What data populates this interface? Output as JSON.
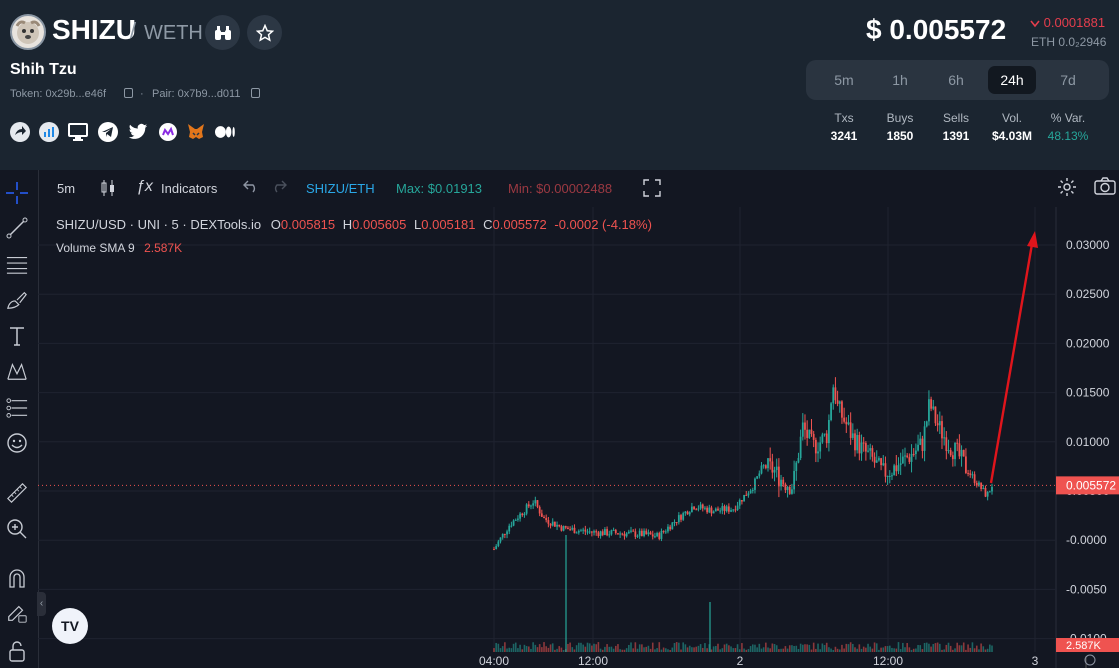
{
  "token": {
    "symbol": "SHIZU",
    "quote": "WETH",
    "name": "Shih Tzu",
    "token_address": "Token: 0x29b...e46f",
    "pair_address": "Pair: 0x7b9...d011"
  },
  "price": {
    "usd": "$ 0.005572",
    "change": "0.0001881",
    "eth": "ETH 0.0₂2946"
  },
  "timeframes": [
    "5m",
    "1h",
    "6h",
    "24h",
    "7d"
  ],
  "active_timeframe": "24h",
  "stats": {
    "headers": [
      "Txs",
      "Buys",
      "Sells",
      "Vol.",
      "% Var."
    ],
    "values": [
      "3241",
      "1850",
      "1391",
      "$4.03M",
      "48.13%"
    ],
    "var_color": "#26a69a"
  },
  "social_icons": [
    "share-icon",
    "chart-icon",
    "website-icon",
    "telegram-icon",
    "twitter-icon",
    "coinmarketcap-icon",
    "metamask-icon",
    "medium-icon"
  ],
  "toolbar": {
    "interval": "5m",
    "indicators": "Indicators",
    "pair": "SHIZU/ETH",
    "max": "Max: $0.01913",
    "min": "Min: $0.00002488"
  },
  "legend": {
    "title": "SHIZU/USD · UNI · 5 · DEXTools.io",
    "o_label": "O",
    "o": "0.005815",
    "h_label": "H",
    "h": "0.005605",
    "l_label": "L",
    "l": "0.005181",
    "c_label": "C",
    "c": "0.005572",
    "change": "-0.0002 (-4.18%)",
    "volume_label": "Volume SMA 9",
    "volume_value": "2.587K"
  },
  "colors": {
    "up": "#26a69a",
    "down": "#ef5350",
    "accent": "#2196f3",
    "arrow": "#e0151c"
  },
  "chart_data": {
    "type": "candlestick",
    "x_tick_labels": [
      "04:00",
      "12:00",
      "2",
      "12:00",
      "3"
    ],
    "y_tick_labels": [
      "0.03000",
      "0.02500",
      "0.02000",
      "0.01500",
      "0.01000",
      "0.00500",
      "-0.0000",
      "-0.0050",
      "-0.0100"
    ],
    "ylim": [
      -0.01,
      0.032
    ],
    "last_price_label": "0.005572",
    "last_price": 0.005572,
    "volume_label": "2.587K",
    "price_path": [
      [
        0.01,
        -0.0001
      ],
      [
        0.03,
        0.0015
      ],
      [
        0.06,
        0.003
      ],
      [
        0.08,
        0.004
      ],
      [
        0.1,
        0.0022
      ],
      [
        0.14,
        0.0012
      ],
      [
        0.2,
        0.0008
      ],
      [
        0.26,
        0.0007
      ],
      [
        0.3,
        0.0006
      ],
      [
        0.33,
        0.0004
      ],
      [
        0.36,
        0.0018
      ],
      [
        0.4,
        0.0035
      ],
      [
        0.44,
        0.003
      ],
      [
        0.48,
        0.0032
      ],
      [
        0.52,
        0.0055
      ],
      [
        0.54,
        0.0075
      ],
      [
        0.56,
        0.0072
      ],
      [
        0.58,
        0.006
      ],
      [
        0.6,
        0.0055
      ],
      [
        0.61,
        0.0085
      ],
      [
        0.62,
        0.0115
      ],
      [
        0.63,
        0.0105
      ],
      [
        0.64,
        0.0095
      ],
      [
        0.655,
        0.01
      ],
      [
        0.67,
        0.0108
      ],
      [
        0.68,
        0.016
      ],
      [
        0.685,
        0.015
      ],
      [
        0.69,
        0.0135
      ],
      [
        0.7,
        0.0125
      ],
      [
        0.72,
        0.0105
      ],
      [
        0.74,
        0.0092
      ],
      [
        0.76,
        0.0082
      ],
      [
        0.78,
        0.0068
      ],
      [
        0.8,
        0.0072
      ],
      [
        0.82,
        0.008
      ],
      [
        0.84,
        0.0088
      ],
      [
        0.86,
        0.0098
      ],
      [
        0.87,
        0.0125
      ],
      [
        0.875,
        0.014
      ],
      [
        0.88,
        0.013
      ],
      [
        0.89,
        0.0118
      ],
      [
        0.91,
        0.01
      ],
      [
        0.93,
        0.0088
      ],
      [
        0.95,
        0.0072
      ],
      [
        0.97,
        0.0058
      ],
      [
        0.99,
        0.0045
      ],
      [
        1.0,
        0.0056
      ]
    ]
  }
}
